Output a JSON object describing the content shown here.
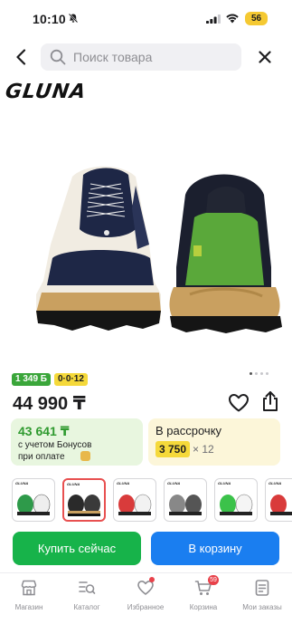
{
  "status_bar": {
    "time": "10:10",
    "battery_level": "56",
    "icons": [
      "bell-off-icon",
      "signal-icon",
      "wifi-icon",
      "battery-icon"
    ]
  },
  "header": {
    "search_placeholder": "Поиск товара",
    "icons": [
      "back-arrow-icon",
      "search-icon",
      "close-icon"
    ]
  },
  "product": {
    "brand": "GLUNA",
    "gallery_count": 4,
    "gallery_active": 0,
    "badges": {
      "bonus": "1 349 Б",
      "installment": "0·0·12"
    },
    "price": "44 990 ₸"
  },
  "offers": {
    "bonus": {
      "amount": "43 641 ₸",
      "line1": "с учетом Бонусов",
      "line2": "при оплате"
    },
    "installment": {
      "title": "В рассрочку",
      "monthly": "3 750",
      "months": "× 12"
    }
  },
  "thumbnails": {
    "count": 6,
    "selected": 1,
    "colors": [
      "#2e9a4a",
      "#2a2a2a",
      "#d93b3b",
      "#888888",
      "#3bc24a",
      "#d93b3b"
    ],
    "logo_text": "GLUNA"
  },
  "actions": {
    "buy_now": "Купить сейчас",
    "add_to_cart": "В корзину"
  },
  "bottom_nav": {
    "items": [
      {
        "label": "Магазин",
        "icon": "store-icon"
      },
      {
        "label": "Каталог",
        "icon": "catalog-icon"
      },
      {
        "label": "Избранное",
        "icon": "heart-icon"
      },
      {
        "label": "Корзина",
        "icon": "cart-icon",
        "badge": "59"
      },
      {
        "label": "Мои заказы",
        "icon": "orders-icon"
      }
    ]
  },
  "colors": {
    "green": "#17b34a",
    "blue": "#1a7ef0",
    "yellow": "#f5d93a",
    "red_badge": "#e8414a"
  }
}
